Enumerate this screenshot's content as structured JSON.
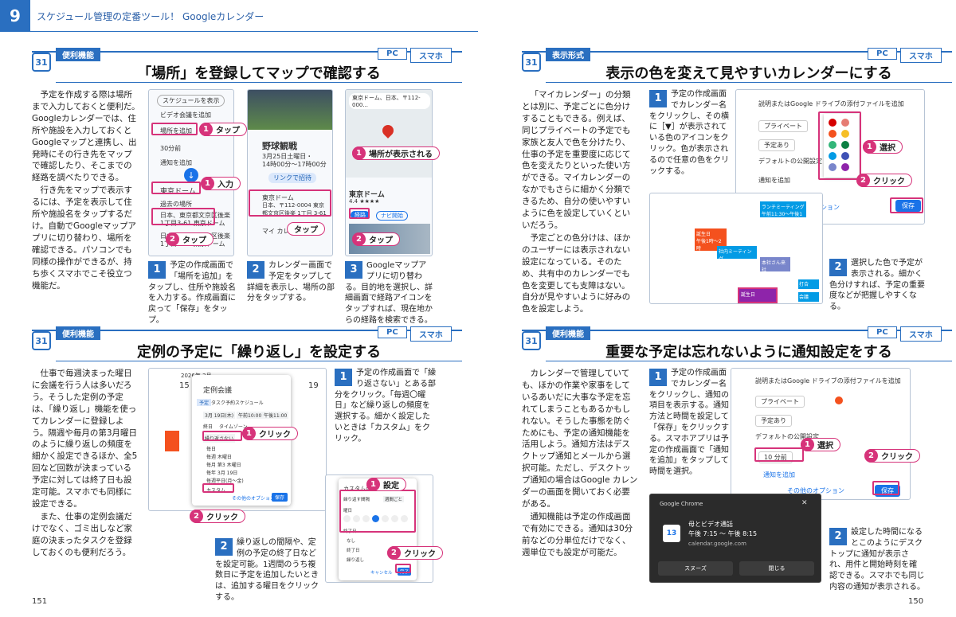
{
  "header": {
    "chapter": "9",
    "title": "スケジュール管理の定番ツール！ Googleカレンダー"
  },
  "tags": {
    "pc": "PC",
    "sp": "スマホ"
  },
  "sections": [
    {
      "category": "便利機能",
      "title": "「場所」を登録してマップで確認する",
      "body": [
        "予定を作成する際は場所まで入力しておくと便利だ。Googleカレンダーでは、住所や施設を入力しておくとGoogleマップと連携し、出発時にその行き先をマップで確認したり、そこまでの経路を調べたりできる。",
        "行き先をマップで表示するには、予定を表示して住所や施設名をタップするだけ。自動でGoogleマップアプリに切り替わり、場所を確認できる。パソコンでも同様の操作ができるが、持ち歩くスマホでこそ役立つ機能だ。"
      ],
      "steps": [
        "予定の作成画面で「場所を追加」をタップし、住所や施設名を入力する。作成画面に戻って「保存」をタップ。",
        "カレンダー画面で予定をタップして詳細を表示し、場所の部分をタップする。",
        "Googleマップアプリに切り替わる。目的地を選択し、詳細画面で経路アイコンをタップすれば、現在地からの経路を検索できる。"
      ]
    },
    {
      "category": "表示形式",
      "title": "表示の色を変えて見やすいカレンダーにする",
      "body": [
        "「マイカレンダー」の分類とは別に、予定ごとに色分けすることもできる。例えば、同じプライベートの予定でも家族と友人で色を分けたり、仕事の予定を重要度に応じて色を変えたりといった使い方ができる。マイカレンダーのなかでもさらに細かく分類できるため、自分の使いやすいように色を設定していくといいだろう。",
        "予定ごとの色分けは、ほかのユーザーには表示されない設定になっている。そのため、共有中のカレンダーでも色を変更しても支障はない。自分が見やすいように好みの色を設定しよう。"
      ],
      "steps": [
        "予定の作成画面でカレンダー名をクリックし、その横に［▼］が表示されている色のアイコンをクリック。色が表示されるので任意の色をクリックする。",
        "選択した色で予定が表示される。細かく色分けすれば、予定の重要度などが把握しやすくなる。"
      ]
    },
    {
      "category": "便利機能",
      "title": "定例の予定に「繰り返し」を設定する",
      "body": [
        "仕事で毎週決まった曜日に会議を行う人は多いだろう。そうした定例の予定は、「繰り返し」機能を使ってカレンダーに登録しよう。隔週や毎月の第3月曜日のように繰り返しの頻度を細かく設定できるほか、全5回など回数が決まっている予定に対しては終了日も設定可能。スマホでも同様に設定できる。",
        "また、仕事の定例会議だけでなく、ゴミ出しなど家庭の決まったタスクを登録しておくのも便利だろう。"
      ],
      "steps": [
        "予定の作成画面で「繰り返さない」とある部分をクリック。「毎週〇曜日」など繰り返しの頻度を選択する。細かく設定したいときは「カスタム」をクリック。",
        "繰り返しの間隔や、定例の予定の終了日などを設定可能。1週間のうち複数日に予定を追加したいときは、追加する曜日をクリックする。"
      ]
    },
    {
      "category": "便利機能",
      "title": "重要な予定は忘れないように通知設定をする",
      "body": [
        "カレンダーで管理していても、ほかの作業や家事をしているあいだに大事な予定を忘れてしまうこともあるかもしれない。そうした事態を防ぐためにも、予定の通知機能を活用しよう。通知方法はデスクトップ通知とメールから選択可能。ただし、デスクトップ通知の場合はGoogle カレンダーの画面を開いておく必要がある。",
        "通知機能は予定の作成画面で有効にできる。通知は30分前などの分単位だけでなく、週単位でも設定が可能だ。"
      ],
      "steps": [
        "予定の作成画面でカレンダー名をクリックし、通知の項目を表示する。通知方法と時間を設定して「保存」をクリックする。スマホアプリは予定の作成画面で「通知を追加」をタップして時間を選択。",
        "設定した時間になるとこのようにデスクトップに通知が表示され、用件と開始時刻を確認できる。スマホでも同じ内容の通知が表示される。"
      ]
    }
  ],
  "callouts": {
    "tap": "タップ",
    "input": "入力",
    "shown": "場所が表示される",
    "select": "選択",
    "click": "クリック",
    "set": "設定"
  },
  "ui": {
    "m1a": "スケジュールを表示",
    "m1b": "ビデオ会議を追加",
    "m1c": "場所を追加",
    "m1d": "30分前",
    "m1e": "通知を追加",
    "m1f": "東京ドーム",
    "m1g": "過去の場所",
    "m1h": "日本、東京都文京区後楽",
    "m1i": "1丁目3-61 東京ドーム",
    "m2a": "野球観戦",
    "m2b": "3月25日土曜日・",
    "m2c": "14時00分～17時00分",
    "m2d": "リンクで招待",
    "m2e": "東京ドーム",
    "m2f": "日本、〒112-0004 東京都文京区後楽 1丁目 3-61",
    "m2g": "マイ カレンダー",
    "m3a": "東京ドーム、日本、〒112-000...",
    "m3b": "東京ドーム",
    "m3c": "4.4 ★★★★",
    "m3d": "経路",
    "m3e": "ナビ開始",
    "c1a": "説明またはGoogle ドライブの添付ファイルを追加",
    "c1b": "プライベート",
    "c1c": "予定あり",
    "c1d": "デフォルトの公開設定",
    "c1e": "通知を追加",
    "c1f": "その他のオプション",
    "c1g": "保存",
    "c2a": "ランチミーティング",
    "c2b": "午前11:30～午後1時",
    "c2c": "社内ミーティング",
    "c2d": "午後4時～",
    "c2e": "誕生日",
    "c2f": "午後1時～2時",
    "c2g": "本社さん来社",
    "c2h": "打合",
    "c2i": "会議",
    "r1a": "2026年 3月",
    "r1b": "定例会議",
    "r1c": "予定",
    "r1d": "タスク",
    "r1e": "予約スケジュール",
    "r1f": "3月 19日(木)",
    "r1g": "午前10:00",
    "r1h": "午後11:00",
    "r1i": "終日",
    "r1j": "タイムゾーン",
    "r1k": "繰り返さない",
    "r1l": "毎日",
    "r1m": "毎週 木曜日",
    "r1n": "毎月 第3 木曜日",
    "r1o": "毎年 3月 19日",
    "r1p": "毎週平日(月～金)",
    "r1q": "カスタム...",
    "r1r": "保存",
    "r1s": "その他のオプション",
    "r1t": "15",
    "r1u": "19",
    "r2a": "カスタムの繰り返し",
    "r2b": "繰り返す間隔",
    "r2c": "週間ごと",
    "r2d": "曜日",
    "r2e": "終了日",
    "r2f": "なし",
    "r2g": "終了日",
    "r2h": "繰り返し",
    "r2i": "キャンセル",
    "r2j": "完了",
    "n1a": "説明またはGoogle ドライブの添付ファイルを追加",
    "n1b": "プライベート",
    "n1c": "予定あり",
    "n1d": "デフォルトの公開設定",
    "n1e": "10 分前",
    "n1f": "通知を追加",
    "n1g": "その他のオプション",
    "n1h": "保存",
    "n2a": "Google Chrome",
    "n2b": "母とビデオ通話",
    "n2c": "午後 7:15 ～ 午後 8:15",
    "n2d": "calendar.google.com",
    "n2e": "スヌーズ",
    "n2f": "閉じる",
    "n2g": "13"
  },
  "colors": {
    "accent": "#2a6fc0",
    "callout": "#d6337a"
  },
  "page_numbers": {
    "left": "151",
    "right": "150"
  }
}
